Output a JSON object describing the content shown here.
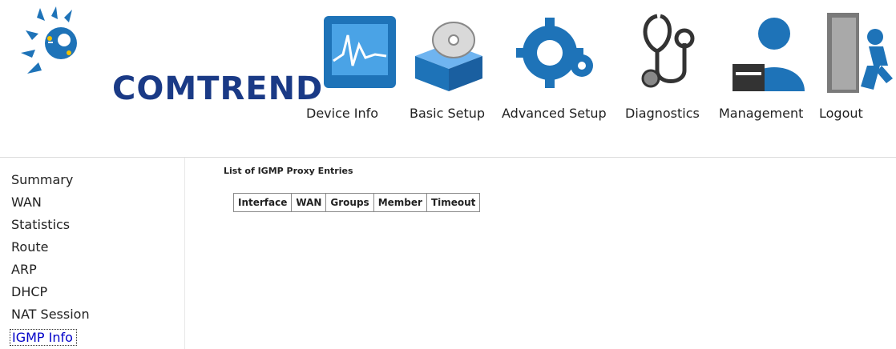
{
  "brand": {
    "logo_text": "COMTREND",
    "colors": {
      "logo_blue": "#1a3a86",
      "icon_blue": "#1e73b8",
      "active_link": "#0000c8"
    }
  },
  "nav": [
    {
      "label": "Device Info",
      "icon": "chart-monitor-icon"
    },
    {
      "label": "Basic Setup",
      "icon": "box-disc-icon"
    },
    {
      "label": "Advanced Setup",
      "icon": "gears-icon"
    },
    {
      "label": "Diagnostics",
      "icon": "stethoscope-icon"
    },
    {
      "label": "Management",
      "icon": "user-admin-icon"
    },
    {
      "label": "Logout",
      "icon": "exit-door-icon"
    }
  ],
  "sidebar": {
    "items": [
      {
        "label": "Summary"
      },
      {
        "label": "WAN"
      },
      {
        "label": "Statistics"
      },
      {
        "label": "Route"
      },
      {
        "label": "ARP"
      },
      {
        "label": "DHCP"
      },
      {
        "label": "NAT Session"
      },
      {
        "label": "IGMP Info",
        "active": true
      }
    ]
  },
  "main": {
    "title": "List of IGMP Proxy Entries",
    "table": {
      "headers": [
        "Interface",
        "WAN",
        "Groups",
        "Member",
        "Timeout"
      ],
      "rows": []
    }
  }
}
